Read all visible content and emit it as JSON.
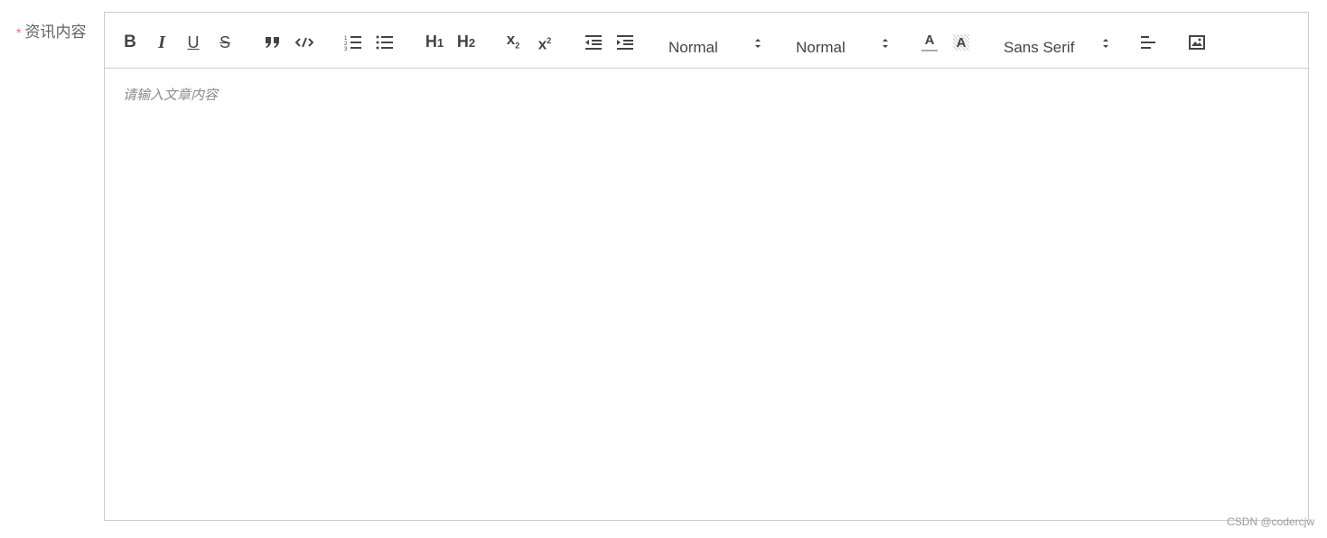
{
  "form": {
    "required_mark": "*",
    "label": "资讯内容"
  },
  "toolbar": {
    "icons": [
      "bold-icon",
      "italic-icon",
      "underline-icon",
      "strike-icon",
      "blockquote-icon",
      "code-block-icon",
      "ordered-list-icon",
      "bullet-list-icon",
      "header-1-icon",
      "header-2-icon",
      "subscript-icon",
      "superscript-icon",
      "outdent-icon",
      "indent-icon",
      "text-color-icon",
      "background-color-icon",
      "align-icon",
      "image-icon"
    ],
    "bold_glyph": "B",
    "italic_glyph": "I",
    "underline_glyph": "U",
    "strike_glyph": "S",
    "h1_glyph": "H",
    "h1_sub": "1",
    "h2_glyph": "H",
    "h2_sub": "2",
    "sub_glyph": "x",
    "sub_mark": "2",
    "sup_glyph": "x",
    "sup_mark": "2",
    "color_glyph": "A",
    "bg_glyph": "A",
    "size_picker": "Normal",
    "header_picker": "Normal",
    "font_picker": "Sans Serif"
  },
  "editor": {
    "placeholder": "请输入文章内容"
  },
  "watermark": "CSDN @codercjw",
  "colors": {
    "icon": "#444444",
    "border": "#cccccc",
    "required": "#f56c6c",
    "label": "#606266",
    "placeholder": "#8c8c8c"
  }
}
